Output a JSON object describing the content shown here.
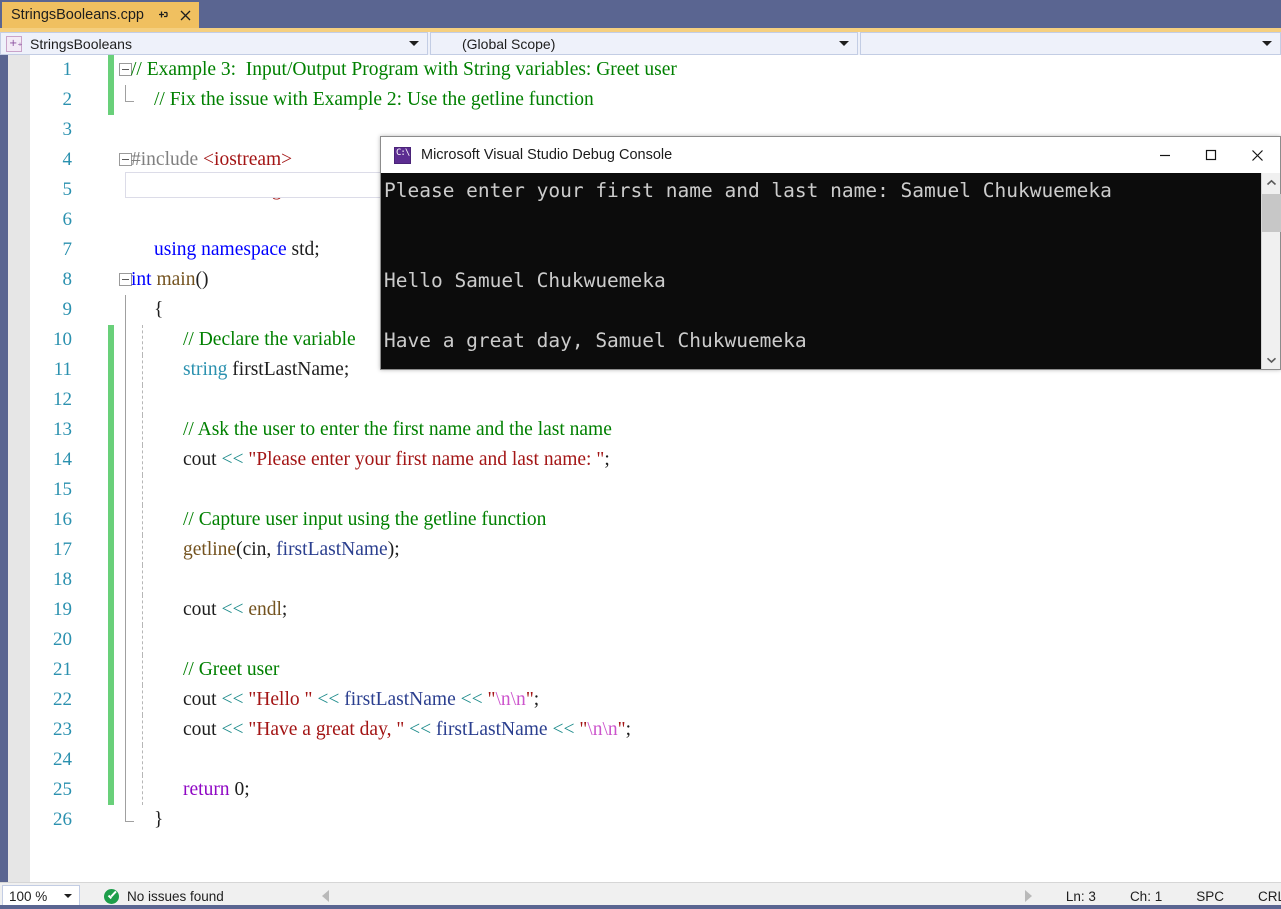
{
  "window": {
    "tab": {
      "label": "StringsBooleans.cpp",
      "pin_icon": "pin-icon",
      "close_icon": "close-icon"
    }
  },
  "navbar": {
    "project_combo": {
      "icon": "cpp-project-icon",
      "value": "StringsBooleans"
    },
    "scope_combo": {
      "value": "(Global Scope)"
    },
    "member_combo": {
      "value": ""
    }
  },
  "editor": {
    "lines": [
      {
        "num": "1",
        "text": "// Example 3:  Input/Output Program with String variables: Greet user"
      },
      {
        "num": "2",
        "text": "// Fix the issue with Example 2: Use the getline function"
      },
      {
        "num": "3",
        "text": ""
      },
      {
        "num": "4",
        "text": "#include <iostream>"
      },
      {
        "num": "5",
        "text": "#include <string>"
      },
      {
        "num": "6",
        "text": ""
      },
      {
        "num": "7",
        "text": "using namespace std;"
      },
      {
        "num": "8",
        "text": "int main()"
      },
      {
        "num": "9",
        "text": "{"
      },
      {
        "num": "10",
        "text": "// Declare the variable"
      },
      {
        "num": "11",
        "text": "string firstLastName;"
      },
      {
        "num": "12",
        "text": ""
      },
      {
        "num": "13",
        "text": "// Ask the user to enter the first name and the last name"
      },
      {
        "num": "14",
        "text": "cout << \"Please enter your first name and last name: \";"
      },
      {
        "num": "15",
        "text": ""
      },
      {
        "num": "16",
        "text": "// Capture user input using the getline function"
      },
      {
        "num": "17",
        "text": "getline(cin, firstLastName);"
      },
      {
        "num": "18",
        "text": ""
      },
      {
        "num": "19",
        "text": "cout << endl;"
      },
      {
        "num": "20",
        "text": ""
      },
      {
        "num": "21",
        "text": "// Greet user"
      },
      {
        "num": "22",
        "text": "cout << \"Hello \" << firstLastName << \"\\n\\n\";"
      },
      {
        "num": "23",
        "text": "cout << \"Have a great day, \" << firstLastName << \"\\n\\n\";"
      },
      {
        "num": "24",
        "text": ""
      },
      {
        "num": "25",
        "text": "return 0;"
      },
      {
        "num": "26",
        "text": "}"
      }
    ],
    "tokens": {
      "l1_comment": "// Example 3:  Input/Output Program with String variables: Greet user",
      "l2_comment": "// Fix the issue with Example 2: Use the getline function",
      "l4_include": "#include ",
      "l4_header": "<iostream>",
      "l5_include": "#include ",
      "l5_header": "<string>",
      "l7_using": "using namespace",
      "l7_std": " std;",
      "l8_int": "int",
      "l8_main": " main",
      "l8_parens": "()",
      "l9_brace": "{",
      "l10_comment": "// Declare the variable",
      "l11_type": "string",
      "l11_var": " firstLastName;",
      "l13_comment": "// Ask the user to enter the first name and the last name",
      "l14_cout": "cout ",
      "l14_op": "<< ",
      "l14_str": "\"Please enter your first name and last name: \"",
      "l14_semi": ";",
      "l16_comment": "// Capture user input using the getline function",
      "l17_fn": "getline",
      "l17_open": "(",
      "l17_cin": "cin",
      "l17_comma": ", ",
      "l17_var": "firstLastName",
      "l17_close": ");",
      "l19_cout": "cout ",
      "l19_op": "<< ",
      "l19_endl": "endl",
      "l19_semi": ";",
      "l21_comment": "// Greet user",
      "l22_cout": "cout ",
      "l22_op1": "<< ",
      "l22_str": "\"Hello \"",
      "l22_op2": " << ",
      "l22_var": "firstLastName",
      "l22_op3": " << ",
      "l22_q1": "\"",
      "l22_esc": "\\n\\n",
      "l22_q2": "\"",
      "l22_semi": ";",
      "l23_cout": "cout ",
      "l23_op1": "<< ",
      "l23_str": "\"Have a great day, \"",
      "l23_op2": " << ",
      "l23_var": "firstLastName",
      "l23_op3": " << ",
      "l23_q1": "\"",
      "l23_esc": "\\n\\n",
      "l23_q2": "\"",
      "l23_semi": ";",
      "l25_return": "return",
      "l25_zero": " 0;",
      "l26_brace": "}"
    },
    "colors": {
      "comment": "#008000",
      "preprocessor": "#808080",
      "string": "#a31515",
      "keyword": "#0000ff",
      "type": "#2b91af",
      "function": "#74531f",
      "operator": "#1b8a8a",
      "variable": "#2b3f8f",
      "escape": "#cc55cc",
      "return_keyword": "#8f08c4",
      "line_number": "#2b91af",
      "change_bar": "#69d07a"
    }
  },
  "console": {
    "title": "Microsoft Visual Studio Debug Console",
    "icon": "console-app-icon",
    "minimize_icon": "minimize-icon",
    "maximize_icon": "maximize-icon",
    "close_icon": "close-icon",
    "output": "Please enter your first name and last name: Samuel Chukwuemeka\n\n\nHello Samuel Chukwuemeka\n\nHave a great day, Samuel Chukwuemeka",
    "scrollbar": {
      "up_icon": "chevron-up-icon",
      "down_icon": "chevron-down-icon"
    }
  },
  "statusbar": {
    "zoom": "100 %",
    "issues": "No issues found",
    "issues_icon": "check-circle-icon",
    "prev_icon": "nav-prev-icon",
    "next_icon": "nav-next-icon",
    "line": "Ln: 3",
    "column": "Ch: 1",
    "spaces": "SPC",
    "line_endings": "CRL"
  }
}
